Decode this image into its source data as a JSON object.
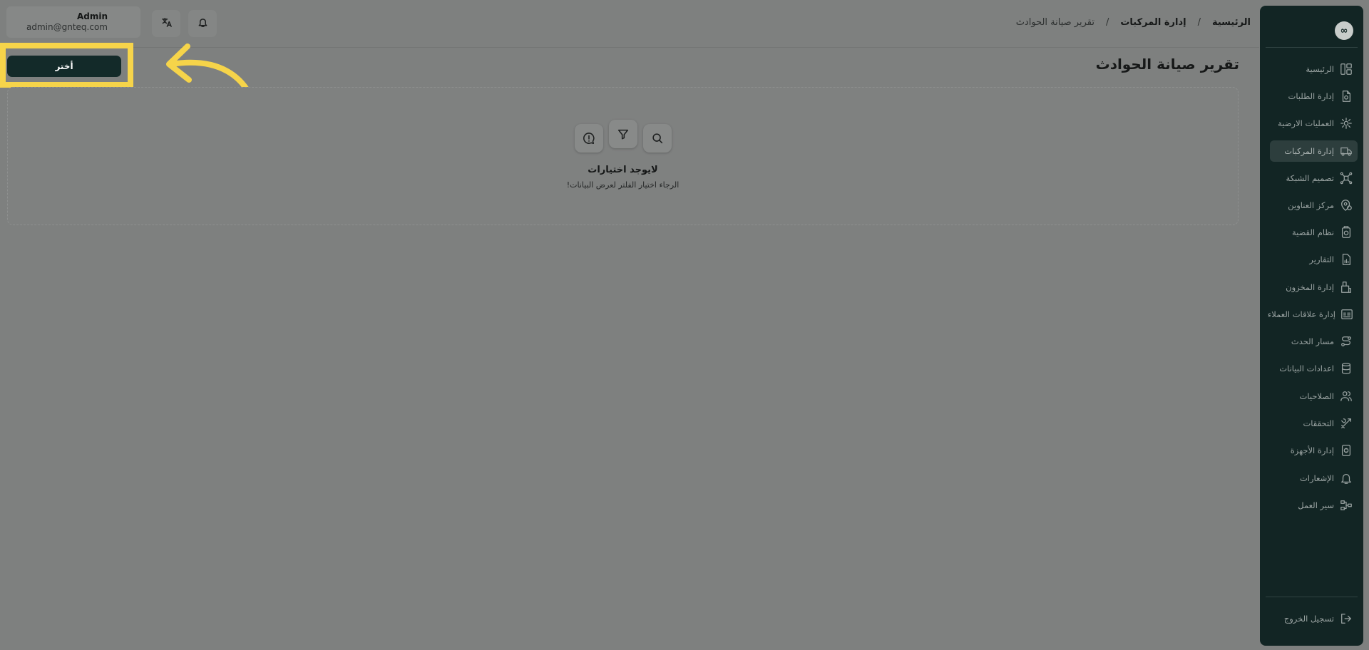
{
  "header": {
    "user_name": "Admin",
    "user_email": "admin@gnteq.com"
  },
  "breadcrumb": {
    "home": "الرئيسية",
    "section": "إدارة المركبات",
    "current": "تقرير صيانة الحوادث",
    "separator": "/"
  },
  "page_title": "تقرير صيانة الحوادث",
  "select_button_label": "أختر",
  "empty_state": {
    "title": "لايوجد اختيارات",
    "description": "الرجاء اختيار الفلتر لعرض البيانات!"
  },
  "sidebar": {
    "logo_glyph": "∞",
    "items": [
      {
        "label": "الرئيسية",
        "icon": "dashboard-icon"
      },
      {
        "label": "إدارة الطلبات",
        "icon": "orders-icon"
      },
      {
        "label": "العمليات الارضية",
        "icon": "ground-ops-icon"
      },
      {
        "label": "إدارة المركبات",
        "icon": "truck-icon",
        "active": true
      },
      {
        "label": "تصميم الشبكة",
        "icon": "network-icon"
      },
      {
        "label": "مركز العناوين",
        "icon": "address-pin-icon"
      },
      {
        "label": "نظام القضية",
        "icon": "case-icon"
      },
      {
        "label": "التقارير",
        "icon": "report-icon"
      },
      {
        "label": "إدارة المخزون",
        "icon": "inventory-icon"
      },
      {
        "label": "إدارة علاقات العملاء",
        "icon": "crm-icon"
      },
      {
        "label": "مسار الحدث",
        "icon": "route-icon"
      },
      {
        "label": "اعدادات البيانات",
        "icon": "database-icon"
      },
      {
        "label": "الصلاحيات",
        "icon": "users-icon"
      },
      {
        "label": "التحققات",
        "icon": "tools-icon"
      },
      {
        "label": "إدارة الأجهزة",
        "icon": "device-icon"
      },
      {
        "label": "الإشعارات",
        "icon": "bell-icon"
      },
      {
        "label": "سير العمل",
        "icon": "workflow-icon"
      }
    ],
    "logout_label": "تسجيل الخروج"
  },
  "colors": {
    "sidebar_bg": "#122524",
    "highlight": "#f6d44a",
    "primary_button": "#132a29"
  }
}
